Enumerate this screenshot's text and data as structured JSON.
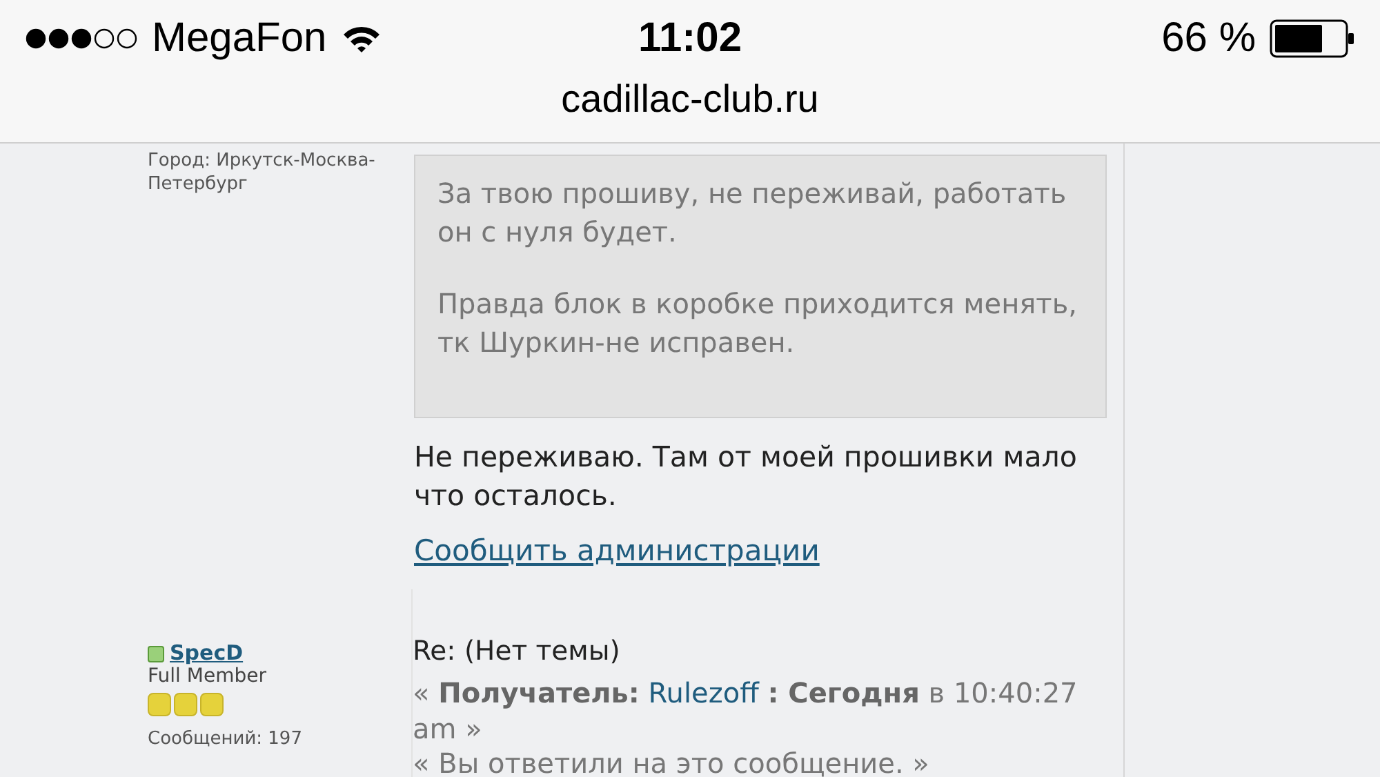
{
  "status_bar": {
    "carrier": "MegaFon",
    "time": "11:02",
    "battery": "66 %"
  },
  "address_bar": {
    "url": "cadillac-club.ru"
  },
  "posts": [
    {
      "author": {
        "location": "Город: Иркутск-Москва-Петербург"
      },
      "quote": [
        "За твою прошиву, не переживай, работать он с нуля будет.",
        "Правда блок в коробке приходится менять, тк Шуркин-не исправен."
      ],
      "body": "Не переживаю. Там от моей прошивки мало что осталось.",
      "report_link": "Сообщить администрации"
    },
    {
      "author": {
        "name": "SpecD",
        "online": true,
        "rank": "Full Member",
        "stars": 3,
        "posts_count": "Сообщений: 197"
      },
      "subject": "Re: (Нет темы)",
      "meta": {
        "before": "« **Получатель:**",
        "recipient": "Rulezoff",
        "after": "**: Сегодня** в 10:40:27 am »"
      },
      "replied_note": "« Вы ответили на это сообщение. »"
    }
  ]
}
